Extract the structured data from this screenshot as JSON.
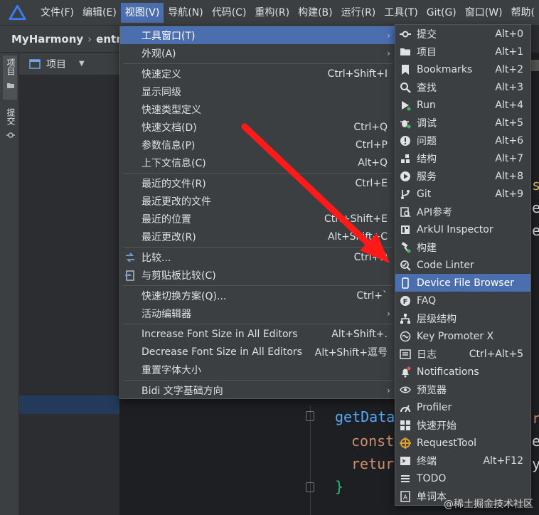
{
  "menubar": {
    "items": [
      "文件(F)",
      "编辑(E)",
      "视图(V)",
      "导航(N)",
      "代码(C)",
      "重构(R)",
      "构建(B)",
      "运行(R)",
      "工具(T)",
      "Git(G)",
      "窗口(W)",
      "帮助("
    ]
  },
  "breadcrumb": {
    "project": "MyHarmony",
    "module": "entry"
  },
  "side_tabs": {
    "project": "项目",
    "commit": "提交"
  },
  "panel": {
    "title": "项目"
  },
  "code": {
    "line1": "getData",
    "line2": "const",
    "line3": "retur",
    "line4": "}",
    "right1": "s",
    "right2": "e",
    "right3": "e",
    "right4": "e",
    "right5": "r",
    "right6": "e",
    "right7": "y"
  },
  "view_menu": [
    {
      "label": "工具窗口(T)",
      "shortcut": "",
      "submenu": true
    },
    {
      "label": "外观(A)",
      "shortcut": "",
      "submenu": true
    },
    {
      "label": "快速定义",
      "shortcut": "Ctrl+Shift+I"
    },
    {
      "label": "显示同级",
      "shortcut": ""
    },
    {
      "label": "快速类型定义",
      "shortcut": ""
    },
    {
      "label": "快速文档(D)",
      "shortcut": "Ctrl+Q"
    },
    {
      "label": "参数信息(P)",
      "shortcut": "Ctrl+P"
    },
    {
      "label": "上下文信息(C)",
      "shortcut": "Alt+Q"
    },
    {
      "label": "最近的文件(R)",
      "shortcut": "Ctrl+E"
    },
    {
      "label": "最近更改的文件",
      "shortcut": ""
    },
    {
      "label": "最近的位置",
      "shortcut": "Ctrl+Shift+E"
    },
    {
      "label": "最近更改(R)",
      "shortcut": "Alt+Shift+C"
    },
    {
      "label": "比较...",
      "shortcut": "Ctrl+D"
    },
    {
      "label": "与剪贴板比较(C)",
      "shortcut": ""
    },
    {
      "label": "快速切换方案(Q)...",
      "shortcut": "Ctrl+`"
    },
    {
      "label": "活动编辑器",
      "shortcut": "",
      "submenu": true
    },
    {
      "label": "Increase Font Size in All Editors",
      "shortcut": "Alt+Shift+."
    },
    {
      "label": "Decrease Font Size in All Editors",
      "shortcut": "Alt+Shift+逗号"
    },
    {
      "label": "重置字体大小",
      "shortcut": ""
    },
    {
      "label": "Bidi 文字基础方向",
      "shortcut": "",
      "submenu": true
    }
  ],
  "tool_windows_menu": [
    {
      "label": "提交",
      "shortcut": "Alt+0",
      "icon": "commit-icon"
    },
    {
      "label": "项目",
      "shortcut": "Alt+1",
      "icon": "folder-icon"
    },
    {
      "label": "Bookmarks",
      "shortcut": "Alt+2",
      "icon": "bookmark-icon"
    },
    {
      "label": "查找",
      "shortcut": "Alt+3",
      "icon": "search-icon"
    },
    {
      "label": "Run",
      "shortcut": "Alt+4",
      "icon": "run-icon"
    },
    {
      "label": "调试",
      "shortcut": "Alt+5",
      "icon": "debug-icon"
    },
    {
      "label": "问题",
      "shortcut": "Alt+6",
      "icon": "problems-icon"
    },
    {
      "label": "结构",
      "shortcut": "Alt+7",
      "icon": "structure-icon"
    },
    {
      "label": "服务",
      "shortcut": "Alt+8",
      "icon": "services-icon"
    },
    {
      "label": "Git",
      "shortcut": "Alt+9",
      "icon": "git-icon"
    },
    {
      "label": "API参考",
      "shortcut": "",
      "icon": "api-reference-icon"
    },
    {
      "label": "ArkUI Inspector",
      "shortcut": "",
      "icon": "inspector-icon"
    },
    {
      "label": "构建",
      "shortcut": "",
      "icon": "build-hammer-icon"
    },
    {
      "label": "Code Linter",
      "shortcut": "",
      "icon": "code-linter-icon"
    },
    {
      "label": "Device File Browser",
      "shortcut": "",
      "icon": "device-icon"
    },
    {
      "label": "FAQ",
      "shortcut": "",
      "icon": "faq-icon"
    },
    {
      "label": "层级结构",
      "shortcut": "",
      "icon": "hierarchy-icon"
    },
    {
      "label": "Key Promoter X",
      "shortcut": "",
      "icon": "key-promoter-icon"
    },
    {
      "label": "日志",
      "shortcut": "Ctrl+Alt+5",
      "icon": "log-icon"
    },
    {
      "label": "Notifications",
      "shortcut": "",
      "icon": "notifications-icon"
    },
    {
      "label": "预览器",
      "shortcut": "",
      "icon": "previewer-eye-icon"
    },
    {
      "label": "Profiler",
      "shortcut": "",
      "icon": "profiler-icon"
    },
    {
      "label": "快速开始",
      "shortcut": "",
      "icon": "quick-start-icon"
    },
    {
      "label": "RequestTool",
      "shortcut": "",
      "icon": "request-tool-icon"
    },
    {
      "label": "终端",
      "shortcut": "Alt+F12",
      "icon": "terminal-icon"
    },
    {
      "label": "TODO",
      "shortcut": "",
      "icon": "todo-icon"
    },
    {
      "label": "单词本",
      "shortcut": "",
      "icon": "wordbook-icon"
    }
  ],
  "watermark": "@稀土掘金技术社区",
  "colors": {
    "accent": "#4b6eaf",
    "arrow": "#ff1a1a",
    "menu_bg": "#3c3f41"
  }
}
